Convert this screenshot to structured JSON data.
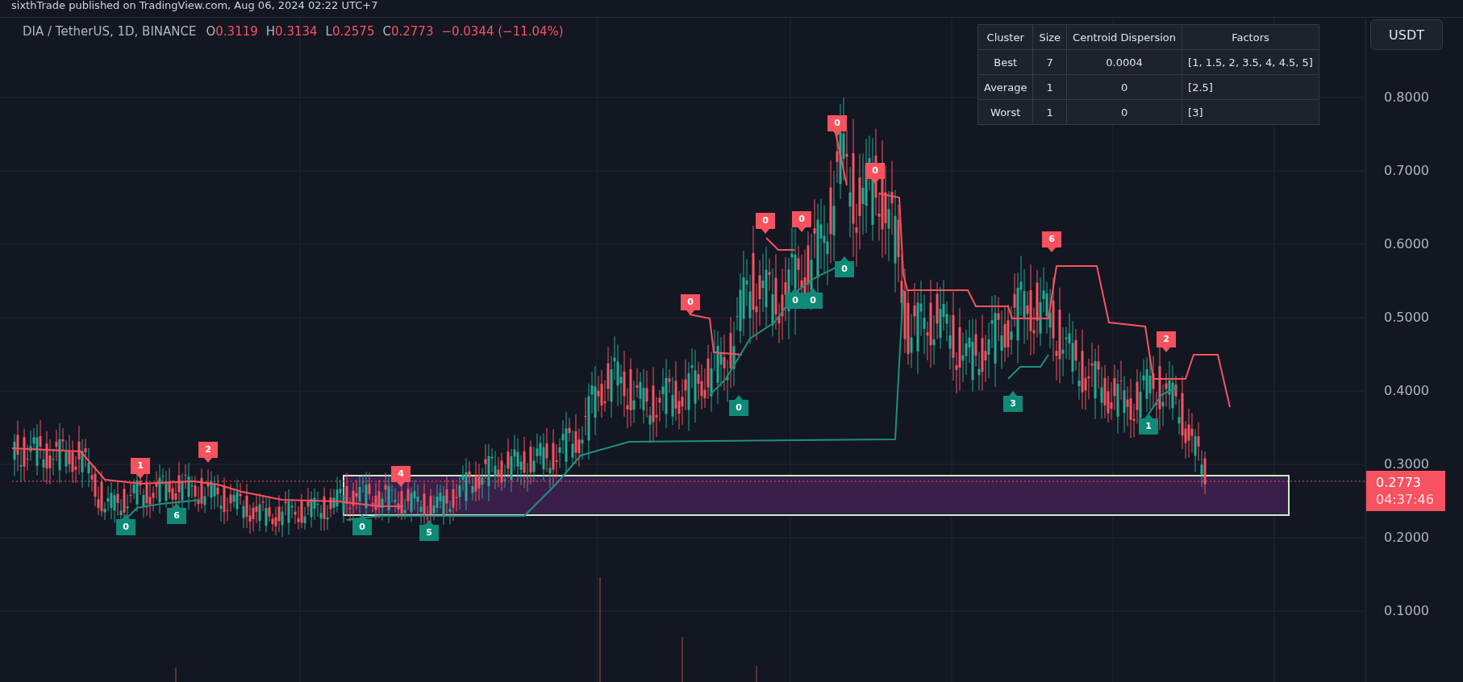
{
  "header": {
    "text": "sixthTrade published on TradingView.com, Aug 06, 2024 02:22 UTC+7"
  },
  "legend": {
    "symbol": "DIA / TetherUS, 1D, BINANCE",
    "ohlc": [
      {
        "key": "O",
        "value": "0.3119"
      },
      {
        "key": "H",
        "value": "0.3134"
      },
      {
        "key": "L",
        "value": "0.2575"
      },
      {
        "key": "C",
        "value": "0.2773"
      }
    ],
    "change": "−0.0344 (−11.04%)"
  },
  "table": {
    "columns": [
      "Cluster",
      "Size",
      "Centroid Dispersion",
      "Factors"
    ],
    "rows": [
      [
        "Best",
        "7",
        "0.0004",
        "[1, 1.5, 2, 3.5, 4, 4.5, 5]"
      ],
      [
        "Average",
        "1",
        "0",
        "[2.5]"
      ],
      [
        "Worst",
        "1",
        "0",
        "[3]"
      ]
    ]
  },
  "currency_button": "USDT",
  "price_axis": {
    "ticks": [
      "0.8000",
      "0.7000",
      "0.6000",
      "0.5000",
      "0.4000",
      "0.3000",
      "0.2000",
      "0.1000"
    ],
    "last_price": "0.2773",
    "countdown": "04:37:46"
  },
  "signals": [
    {
      "kind": "sell",
      "label": "1"
    },
    {
      "kind": "sell",
      "label": "2"
    },
    {
      "kind": "sell",
      "label": "4"
    },
    {
      "kind": "sell",
      "label": "0"
    },
    {
      "kind": "sell",
      "label": "0"
    },
    {
      "kind": "sell",
      "label": "0"
    },
    {
      "kind": "sell",
      "label": "0"
    },
    {
      "kind": "sell",
      "label": "0"
    },
    {
      "kind": "sell",
      "label": "6"
    },
    {
      "kind": "sell",
      "label": "2"
    },
    {
      "kind": "buy",
      "label": "0"
    },
    {
      "kind": "buy",
      "label": "6"
    },
    {
      "kind": "buy",
      "label": "0"
    },
    {
      "kind": "buy",
      "label": "5"
    },
    {
      "kind": "buy",
      "label": "0"
    },
    {
      "kind": "buy",
      "label": "0"
    },
    {
      "kind": "buy",
      "label": "0"
    },
    {
      "kind": "buy",
      "label": "0"
    },
    {
      "kind": "buy",
      "label": "3"
    },
    {
      "kind": "buy",
      "label": "1"
    }
  ]
}
